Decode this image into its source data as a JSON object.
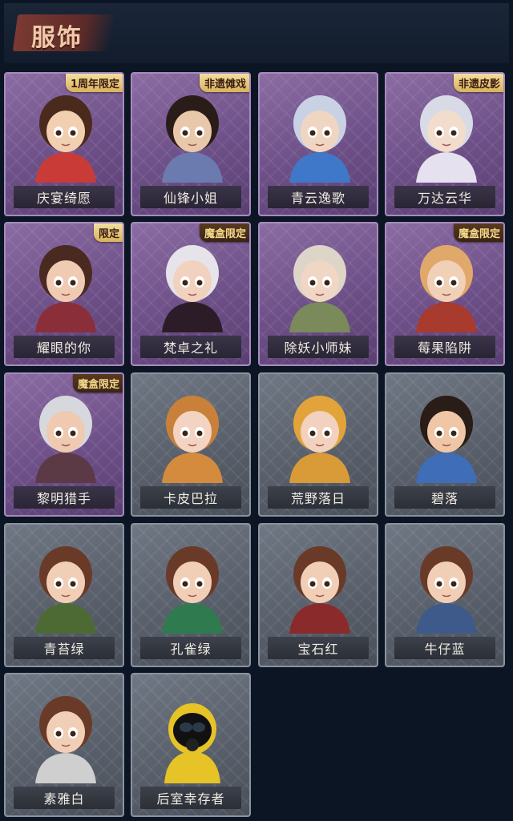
{
  "header": {
    "title": "服饰"
  },
  "costumes": [
    {
      "name": "庆宴绮愿",
      "badge": "1周年限定",
      "theme": "purple",
      "hair": "#4a2a1c",
      "skin": "#f1cfb0",
      "outfit": "#c93b36"
    },
    {
      "name": "仙锋小姐",
      "badge": "非遗傩戏",
      "theme": "purple",
      "hair": "#2a1c18",
      "skin": "#e9c7aa",
      "outfit": "#6b7bb0"
    },
    {
      "name": "青云逸歌",
      "badge": "",
      "theme": "purple",
      "hair": "#c9d2e4",
      "skin": "#f0d6c2",
      "outfit": "#3f78c8"
    },
    {
      "name": "万达云华",
      "badge": "非遗皮影",
      "theme": "purple",
      "hair": "#d8dbe6",
      "skin": "#f2dccc",
      "outfit": "#e6e1ef"
    },
    {
      "name": "耀眼的你",
      "badge": "限定",
      "theme": "purple",
      "hair": "#4a2a20",
      "skin": "#f0cbb4",
      "outfit": "#8a2f3a"
    },
    {
      "name": "梵卓之礼",
      "badge": "魔盒限定",
      "theme": "purple",
      "hair": "#e6e4ea",
      "skin": "#f1d2bf",
      "outfit": "#2c1c28"
    },
    {
      "name": "除妖小师妹",
      "badge": "",
      "theme": "purple",
      "hair": "#ddd6c8",
      "skin": "#f0d6c4",
      "outfit": "#7a8a5a"
    },
    {
      "name": "莓果陷阱",
      "badge": "魔盒限定",
      "theme": "purple",
      "hair": "#e0a86a",
      "skin": "#f1d0b8",
      "outfit": "#a83a2e"
    },
    {
      "name": "黎明猎手",
      "badge": "魔盒限定",
      "theme": "purple",
      "hair": "#d7d7de",
      "skin": "#efcab0",
      "outfit": "#5b3a46"
    },
    {
      "name": "卡皮巴拉",
      "badge": "",
      "theme": "gray",
      "hair": "#c9813a",
      "skin": "#f3d3c2",
      "outfit": "#d48b3d"
    },
    {
      "name": "荒野落日",
      "badge": "",
      "theme": "gray",
      "hair": "#e2a43a",
      "skin": "#f2d1be",
      "outfit": "#d99a38"
    },
    {
      "name": "碧落",
      "badge": "",
      "theme": "gray",
      "hair": "#2a1c16",
      "skin": "#efc7a6",
      "outfit": "#3f6db8"
    },
    {
      "name": "青苔绿",
      "badge": "",
      "theme": "gray",
      "hair": "#6a3a28",
      "skin": "#f1cfb6",
      "outfit": "#4d6a35"
    },
    {
      "name": "孔雀绿",
      "badge": "",
      "theme": "gray",
      "hair": "#6a3a28",
      "skin": "#f1cfb6",
      "outfit": "#2f7a4f"
    },
    {
      "name": "宝石红",
      "badge": "",
      "theme": "gray",
      "hair": "#6a3a28",
      "skin": "#f1cfb6",
      "outfit": "#8a2a2a"
    },
    {
      "name": "牛仔蓝",
      "badge": "",
      "theme": "gray",
      "hair": "#6a3a28",
      "skin": "#f1cfb6",
      "outfit": "#3d5a8a"
    },
    {
      "name": "素雅白",
      "badge": "",
      "theme": "gray",
      "hair": "#6a3a28",
      "skin": "#f1cfb6",
      "outfit": "#cfcfcf"
    },
    {
      "name": "后室幸存者",
      "badge": "",
      "theme": "gray",
      "hair": "#e6c326",
      "skin": "#111111",
      "outfit": "#e6c326"
    }
  ]
}
